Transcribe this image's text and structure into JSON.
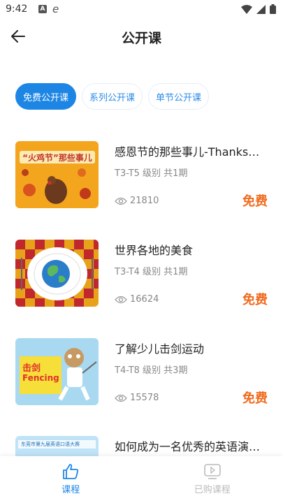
{
  "status": {
    "time": "9:42",
    "a_label": "A",
    "e_label": "e"
  },
  "header": {
    "title": "公开课"
  },
  "tabs": [
    {
      "label": "免费公开课",
      "active": true
    },
    {
      "label": "系列公开课",
      "active": false
    },
    {
      "label": "单节公开课",
      "active": false
    }
  ],
  "courses": [
    {
      "title": "感恩节的那些事儿-Thanks…",
      "level": "T3-T5 级别  共1期",
      "views": "21810",
      "price": "免费",
      "thumb_text": "“火鸡节”那些事儿"
    },
    {
      "title": "世界各地的美食",
      "level": "T3-T4 级别  共1期",
      "views": "16624",
      "price": "免费"
    },
    {
      "title": "了解少儿击剑运动",
      "level": "T4-T8 级别  共3期",
      "views": "15578",
      "price": "免费",
      "thumb_text": "击剑",
      "thumb_sub": "Fencing"
    },
    {
      "title": "如何成为一名优秀的英语演…",
      "thumb_text": "东莞市第九届英语口语大赛"
    }
  ],
  "nav": [
    {
      "label": "课程",
      "active": true
    },
    {
      "label": "已购课程",
      "active": false
    }
  ],
  "colors": {
    "accent": "#1d86e5",
    "price": "#f06a1c"
  }
}
